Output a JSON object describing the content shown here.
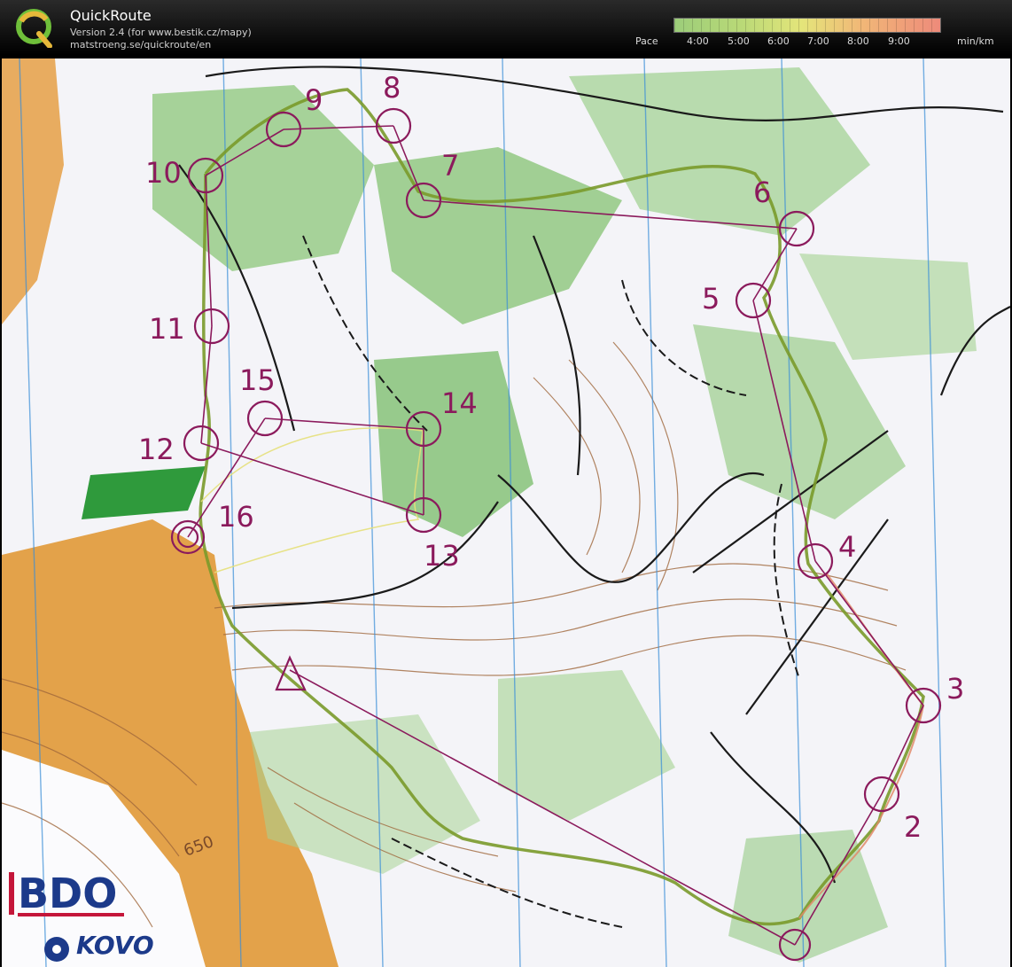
{
  "app": {
    "title": "QuickRoute",
    "version": "Version 2.4  (for www.bestik.cz/mapy)",
    "url": "matstroeng.se/quickroute/en"
  },
  "pace": {
    "label": "Pace",
    "ticks": [
      "4:00",
      "5:00",
      "6:00",
      "7:00",
      "8:00",
      "9:00"
    ],
    "unit": "min/km"
  },
  "map": {
    "controls": [
      "2",
      "3",
      "4",
      "5",
      "6",
      "7",
      "8",
      "9",
      "10",
      "11",
      "12",
      "13",
      "14",
      "15",
      "16"
    ],
    "contour_label": "650",
    "sponsors": [
      "BDO",
      "KOVO"
    ],
    "colors": {
      "route": "#8b1a5c",
      "forest": "#7fbf6a",
      "open": "#e3a24a",
      "water": "#3a8ed8",
      "track": "#7a9a2a"
    }
  }
}
